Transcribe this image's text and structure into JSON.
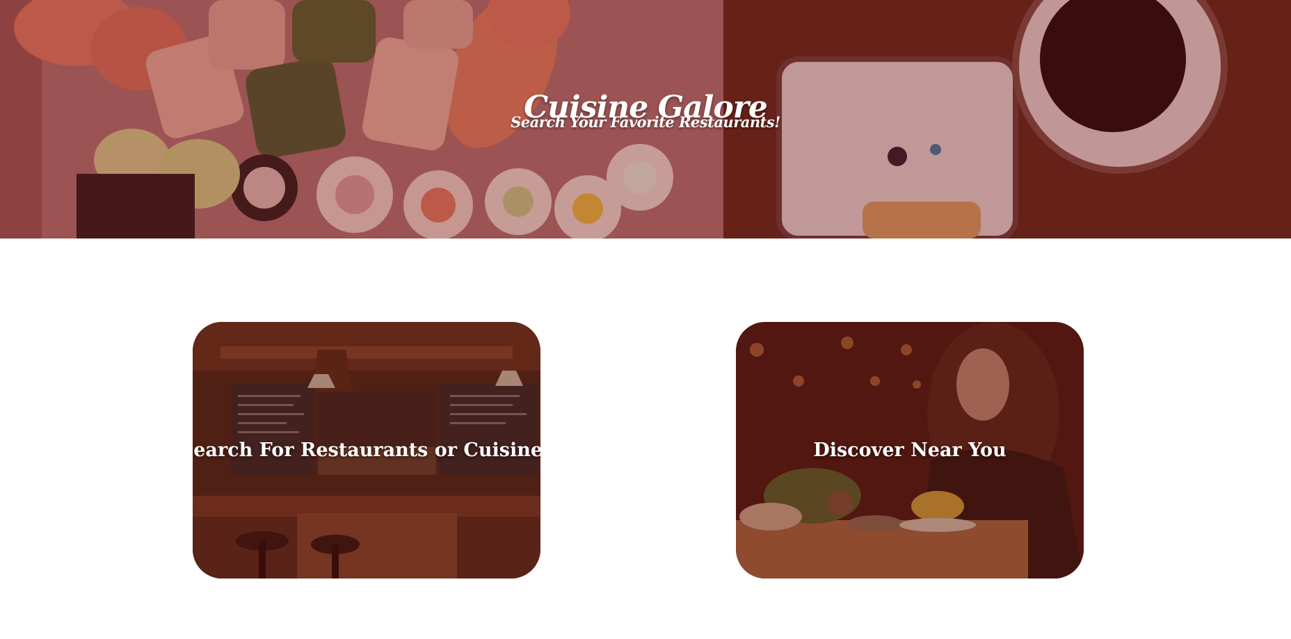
{
  "hero": {
    "title": "Cuisine Galore",
    "subtitle": "Search Your Favorite Restaurants!",
    "background_image": "sushi-platter-image"
  },
  "cards": [
    {
      "label": "Search For Restaurants or Cuisines",
      "background_image": "restaurant-bar-interior-image"
    },
    {
      "label": "Discover Near You",
      "background_image": "woman-dining-cafe-image"
    }
  ],
  "colors": {
    "hero_tint": "#9a4a45",
    "card_tint": "#5a140f",
    "text": "#ffffff",
    "page_background": "#ffffff"
  }
}
